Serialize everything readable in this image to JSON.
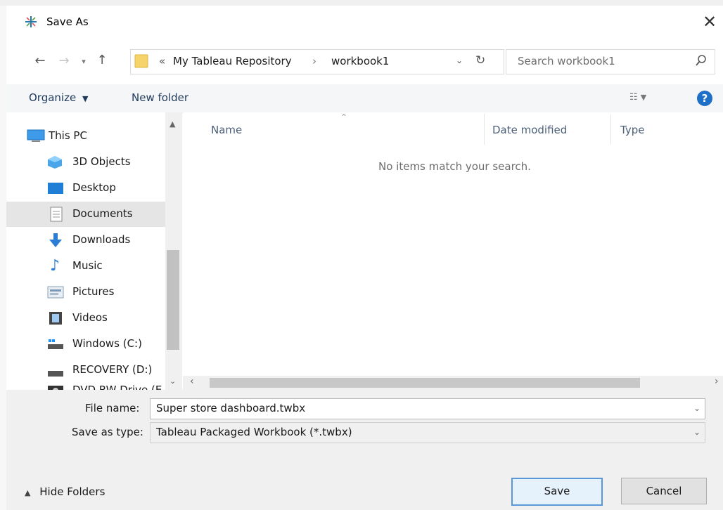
{
  "window": {
    "title": "Save As",
    "close_icon": "close-icon"
  },
  "navigation": {
    "back_icon": "back-arrow-icon",
    "forward_icon": "forward-arrow-icon",
    "recent_icon": "chevron-down-icon",
    "up_icon": "up-arrow-icon"
  },
  "address_bar": {
    "overflow": "«",
    "crumbs": [
      "My Tableau Repository",
      "workbook1"
    ],
    "separator": "›"
  },
  "search": {
    "placeholder": "Search workbook1"
  },
  "command_bar": {
    "organize_label": "Organize",
    "new_folder_label": "New folder"
  },
  "nav_pane": {
    "items": [
      {
        "label": "This PC",
        "icon": "this-pc-icon"
      },
      {
        "label": "3D Objects",
        "icon": "3d-objects-icon"
      },
      {
        "label": "Desktop",
        "icon": "desktop-icon"
      },
      {
        "label": "Documents",
        "icon": "documents-icon",
        "selected": true
      },
      {
        "label": "Downloads",
        "icon": "downloads-icon"
      },
      {
        "label": "Music",
        "icon": "music-icon"
      },
      {
        "label": "Pictures",
        "icon": "pictures-icon"
      },
      {
        "label": "Videos",
        "icon": "videos-icon"
      },
      {
        "label": "Windows (C:)",
        "icon": "drive-c-icon"
      },
      {
        "label": "RECOVERY (D:)",
        "icon": "drive-d-icon"
      },
      {
        "label": "DVD RW Drive (E",
        "icon": "dvd-drive-icon"
      }
    ]
  },
  "file_list": {
    "columns": [
      "Name",
      "Date modified",
      "Type"
    ],
    "empty_message": "No items match your search."
  },
  "form": {
    "file_name_label": "File name:",
    "file_name_value": "Super store dashboard.twbx",
    "save_type_label": "Save as type:",
    "save_type_value": "Tableau Packaged Workbook (*.twbx)"
  },
  "footer": {
    "hide_folders_label": "Hide Folders",
    "save_label": "Save",
    "cancel_label": "Cancel"
  },
  "colors": {
    "accent": "#0078d7",
    "help": "#1e6fc8"
  }
}
